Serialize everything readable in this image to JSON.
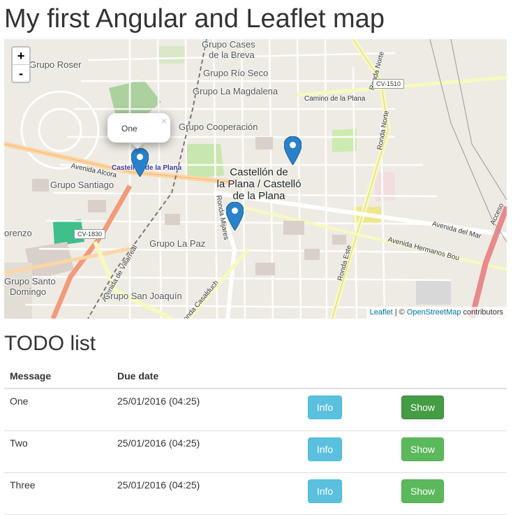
{
  "page": {
    "title": "My first Angular and Leaflet map"
  },
  "map": {
    "zoom_in": "+",
    "zoom_out": "-",
    "labels": {
      "grupo_cases": "Grupo Cases",
      "de_la_breva": "de la Breva",
      "grupo_roser": "Grupo Roser",
      "grupo_rio_seco": "Grupo Río Seco",
      "grupo_la_magdalena": "Grupo La Magdalena",
      "camino_de_la_plana": "Camino de la Plana",
      "grupo_cooperacion": "Grupo Cooperación",
      "grupo_santiago": "Grupo Santiago",
      "avenida_alcora": "Avenida Alcora",
      "castellon_station": "Castellón de la Plana",
      "city_line1": "Castellón de",
      "city_line2": "la Plana / Castelló",
      "city_line3": "de la Plana",
      "ronda_norte": "Ronda Norte",
      "ronda_norte2": "Ronda Norte",
      "ronda_mijares": "Ronda Mijares",
      "orenzo": "orenzo",
      "grupo_la_paz": "Grupo La Paz",
      "avenida_de_villarreal": "Avenida de Villarreal",
      "grupo_santo": "Grupo Santo",
      "domingo": "Domingo",
      "grupo_san_joaquin": "Grupo San Joaquín",
      "ronda_casalduch": "Ronda Casalduch",
      "ronda_este": "Ronda Este",
      "avenida_del_mar": "Avenida del Mar",
      "avenida_hermanos_bou": "Avenida Hermanos Bou",
      "accesso": "Acceso",
      "cv_1510": "CV-1510",
      "cv_1830": "CV-1830"
    },
    "popup": {
      "text": "One",
      "close": "×"
    },
    "markers": [
      "One",
      "Two",
      "Three"
    ],
    "attribution": {
      "leaflet": "Leaflet",
      "separator": " | © ",
      "osm": "OpenStreetMap",
      "suffix": " contributors"
    }
  },
  "todo": {
    "title": "TODO list",
    "columns": [
      "Message",
      "Due date",
      "",
      ""
    ],
    "rows": [
      {
        "message": "One",
        "due": "25/01/2016 (04:25)",
        "info": "Info",
        "show": "Show"
      },
      {
        "message": "Two",
        "due": "25/01/2016 (04:25)",
        "info": "Info",
        "show": "Show"
      },
      {
        "message": "Three",
        "due": "25/01/2016 (04:25)",
        "info": "Info",
        "show": "Show"
      }
    ]
  },
  "colors": {
    "marker": "#2a81cb",
    "info": "#5bc0de",
    "success": "#5cb85c",
    "success_active": "#449d44"
  }
}
